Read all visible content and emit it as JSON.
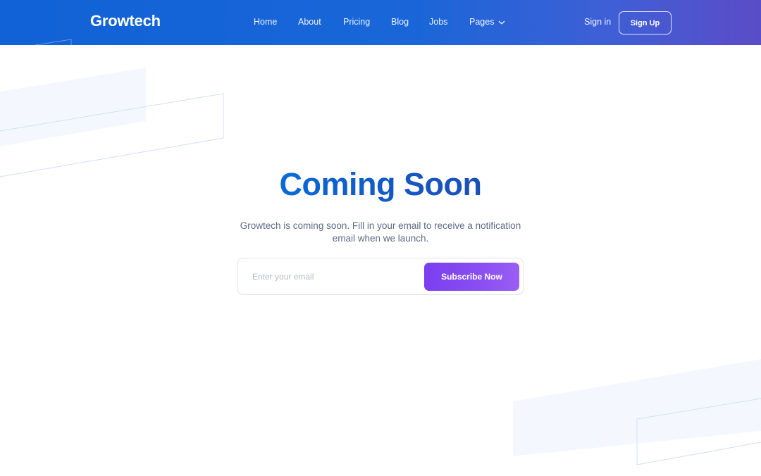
{
  "header": {
    "logo": "Growtech",
    "nav": [
      {
        "label": "Home"
      },
      {
        "label": "About"
      },
      {
        "label": "Pricing"
      },
      {
        "label": "Blog"
      },
      {
        "label": "Jobs"
      },
      {
        "label": "Pages",
        "has_dropdown": true
      }
    ],
    "sign_in": "Sign in",
    "sign_up": "Sign Up"
  },
  "hero": {
    "title": "Coming Soon",
    "description": "Growtech is coming soon. Fill in your email to receive a notification email when we launch.",
    "email_placeholder": "Enter your email",
    "email_value": "",
    "subscribe_label": "Subscribe Now"
  },
  "icons": {
    "pages_dropdown": "chevron-down-icon"
  },
  "colors": {
    "header_start": "#1062d6",
    "header_end": "#5b4cc7",
    "title": "#0f5ecf",
    "subscribe_start": "#7b3ff0",
    "subscribe_end": "#9a5ff4",
    "body_text": "#5d6b85"
  }
}
